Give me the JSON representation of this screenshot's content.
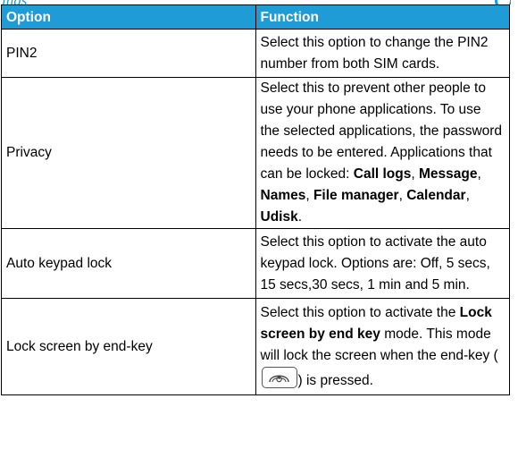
{
  "page": {
    "header_fragment": "ings"
  },
  "table": {
    "headers": {
      "option": "Option",
      "function": "Function"
    },
    "rows": [
      {
        "option": "PIN2",
        "function": [
          {
            "text": "Select this option to change the PIN2 number from both SIM cards.",
            "bold": false
          }
        ]
      },
      {
        "option": "Privacy",
        "function": [
          {
            "text": "Select this to prevent other people to use your phone applications. To use the selected applications, the password needs to be entered. Applications that can be locked: ",
            "bold": false
          },
          {
            "text": "Call logs",
            "bold": true
          },
          {
            "text": ", ",
            "bold": false
          },
          {
            "text": "Message",
            "bold": true
          },
          {
            "text": ", ",
            "bold": false
          },
          {
            "text": "Names",
            "bold": true
          },
          {
            "text": ", ",
            "bold": false
          },
          {
            "text": "File manager",
            "bold": true
          },
          {
            "text": ", ",
            "bold": false
          },
          {
            "text": "Calendar",
            "bold": true
          },
          {
            "text": ", ",
            "bold": false
          },
          {
            "text": "Udisk",
            "bold": true
          },
          {
            "text": ".",
            "bold": false
          }
        ]
      },
      {
        "option": "Auto keypad lock",
        "function": [
          {
            "text": "Select this option to activate the auto keypad lock. Options are: Off, 5 secs, 15 secs,30 secs, 1 min and 5 min.",
            "bold": false
          }
        ]
      },
      {
        "option": "Lock screen by end-key",
        "function": [
          {
            "text": "Select this option to activate the ",
            "bold": false
          },
          {
            "text": "Lock screen by end key",
            "bold": true
          },
          {
            "text": " mode. This mode will lock the screen when the end-key (",
            "bold": false
          },
          {
            "icon": "end-key-icon"
          },
          {
            "text": ") is pressed.",
            "bold": false
          }
        ]
      }
    ]
  },
  "colors": {
    "header_bg": "#1f9bd5",
    "header_text": "#ffffff",
    "border": "#000000"
  }
}
